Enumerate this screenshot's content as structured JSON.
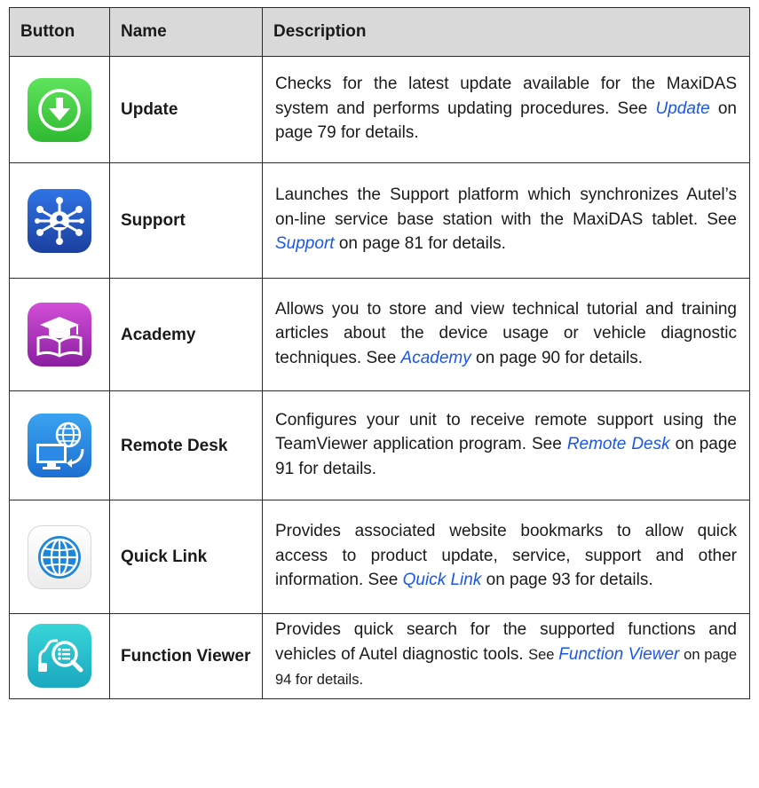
{
  "headers": {
    "button": "Button",
    "name": "Name",
    "description": "Description"
  },
  "rows": [
    {
      "icon": "update-icon",
      "name": "Update",
      "desc_pre": "Checks for the latest update available for the MaxiDAS system and performs updating procedures. See ",
      "link": "Update",
      "desc_post": " on page 79 for details."
    },
    {
      "icon": "support-icon",
      "name": "Support",
      "desc_pre": "Launches the Support platform which synchronizes Autel’s on-line service base station with the MaxiDAS tablet. See ",
      "link": "Support",
      "desc_post": " on page 81 for details."
    },
    {
      "icon": "academy-icon",
      "name": "Academy",
      "desc_pre": "Allows you to store and view technical tutorial and training articles about the device usage or vehicle diagnostic techniques. See ",
      "link": "Academy",
      "desc_post": " on page 90 for details."
    },
    {
      "icon": "remote-desk-icon",
      "name": "Remote Desk",
      "desc_pre": "Configures your unit to receive remote support using the TeamViewer application program. See ",
      "link": "Remote Desk",
      "desc_post": " on page 91 for details."
    },
    {
      "icon": "quick-link-icon",
      "name": "Quick Link",
      "desc_pre": "Provides associated website bookmarks to allow quick access to product update, service, support and other information. See ",
      "link": "Quick Link",
      "desc_post": " on page 93 for details."
    },
    {
      "icon": "function-viewer-icon",
      "name": "Function Viewer",
      "desc_pre": "Provides quick search for the supported functions and vehicles of Autel diagnostic tools. ",
      "desc_small": "See ",
      "link": "Function Viewer",
      "desc_post": " on page 94 for details."
    }
  ]
}
